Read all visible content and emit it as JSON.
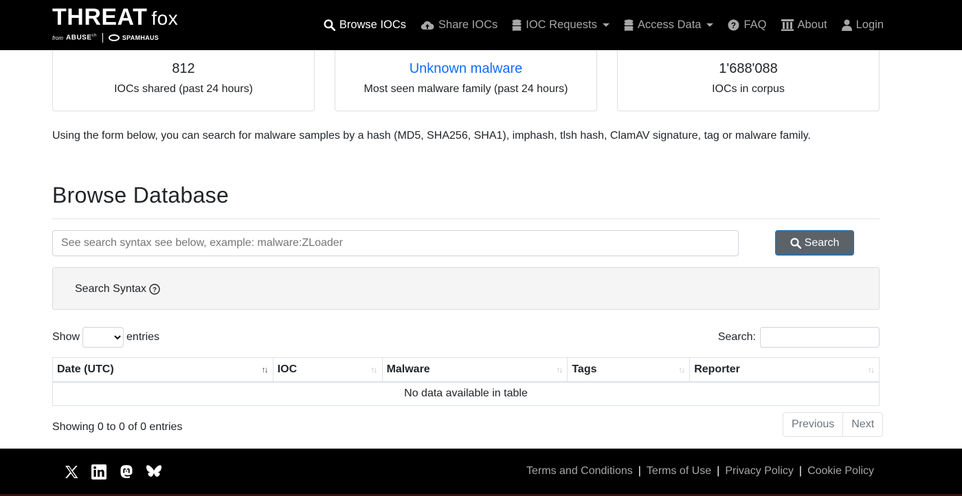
{
  "brand": {
    "main": "THREAT",
    "sub": "fox",
    "from": "from",
    "abuse": "ABUSE",
    "abuse_sup": "ch",
    "spamhaus": "SPAMHAUS"
  },
  "nav": {
    "items": [
      {
        "label": "Browse IOCs",
        "icon": "search-icon"
      },
      {
        "label": "Share IOCs",
        "icon": "cloud-upload-icon"
      },
      {
        "label": "IOC Requests",
        "icon": "database-icon"
      },
      {
        "label": "Access Data",
        "icon": "database-icon"
      },
      {
        "label": "FAQ",
        "icon": "question-circle-icon"
      },
      {
        "label": "About",
        "icon": "bank-icon"
      },
      {
        "label": "Login",
        "icon": "user-icon"
      }
    ]
  },
  "stats": [
    {
      "value": "812",
      "label": "IOCs shared (past 24 hours)"
    },
    {
      "value": "Unknown malware",
      "label": "Most seen malware family (past 24 hours)"
    },
    {
      "value": "1'688'088",
      "label": "IOCs in corpus"
    }
  ],
  "intro": "Using the form below, you can search for malware samples by a hash (MD5, SHA256, SHA1), imphash, tlsh hash, ClamAV signature, tag or malware family.",
  "browse": {
    "title": "Browse Database",
    "search_placeholder": "See search syntax see below, example: malware:ZLoader",
    "search_button": "Search",
    "syntax_label": "Search Syntax"
  },
  "table": {
    "show_label": "Show",
    "entries_label": "entries",
    "search_label": "Search:",
    "columns": [
      "Date (UTC)",
      "IOC",
      "Malware",
      "Tags",
      "Reporter"
    ],
    "empty": "No data available in table",
    "info": "Showing 0 to 0 of 0 entries",
    "prev": "Previous",
    "next": "Next"
  },
  "footer": {
    "social": [
      "x-icon",
      "linkedin-icon",
      "mastodon-icon",
      "bluesky-icon"
    ],
    "links": [
      "Terms and Conditions",
      "Terms of Use",
      "Privacy Policy",
      "Cookie Policy"
    ]
  },
  "colors": {
    "navbar": "#000000",
    "link": "#0d6efd",
    "button": "#5b6268"
  }
}
